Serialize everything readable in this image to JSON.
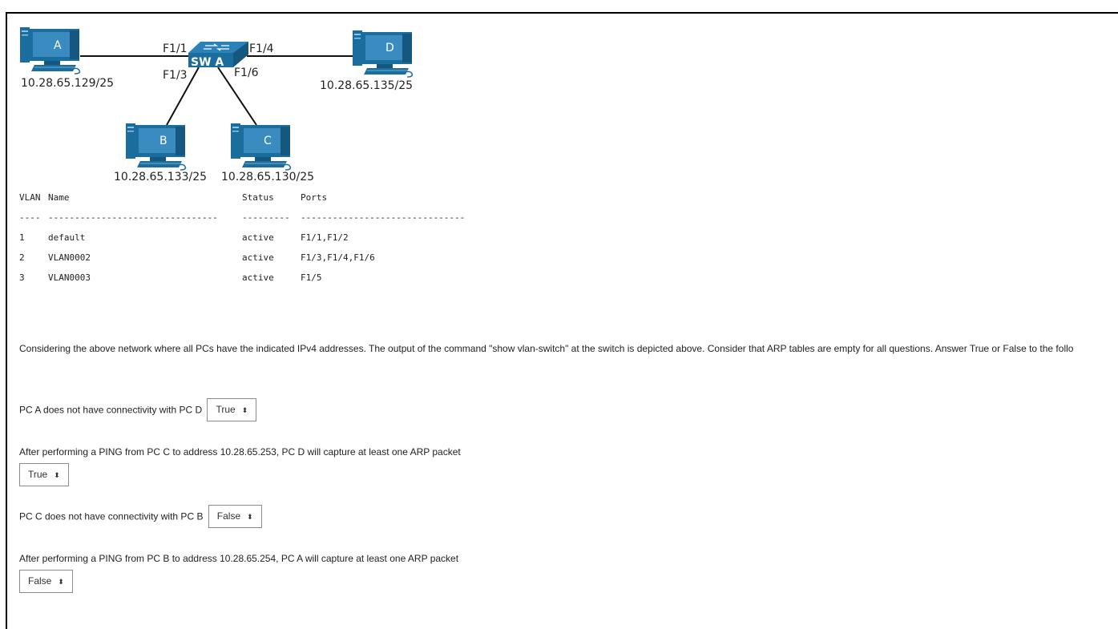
{
  "diagram": {
    "switch_label": "SW A",
    "pcs": [
      {
        "id": "A",
        "ip": "10.28.65.129/25"
      },
      {
        "id": "B",
        "ip": "10.28.65.133/25"
      },
      {
        "id": "C",
        "ip": "10.28.65.130/25"
      },
      {
        "id": "D",
        "ip": "10.28.65.135/25"
      }
    ],
    "ports": {
      "a": "F1/1",
      "b": "F1/3",
      "c": "F1/6",
      "d": "F1/4"
    },
    "colors": {
      "device": "#1b6d9e",
      "line": "#111111"
    }
  },
  "vlan_table": {
    "headers": [
      "VLAN",
      "Name",
      "Status",
      "Ports"
    ],
    "separator": [
      "----",
      "--------------------------------",
      "---------",
      "-------------------------------"
    ],
    "rows": [
      [
        "1",
        "default",
        "active",
        "F1/1,F1/2"
      ],
      [
        "2",
        "VLAN0002",
        "active",
        "F1/3,F1/4,F1/6"
      ],
      [
        "3",
        "VLAN0003",
        "active",
        "F1/5"
      ]
    ]
  },
  "intro": "Considering the above network where all PCs have the indicated IPv4 addresses. The output of the command \"show vlan-switch\" at the switch is depicted above. Consider that ARP tables are empty for all questions. Answer True or False to the follo",
  "questions": [
    {
      "text": "PC A does not have connectivity with PC D",
      "answer": "True"
    },
    {
      "text": "After performing a PING from PC C to address 10.28.65.253, PC D will capture at least one ARP packet",
      "answer": "True"
    },
    {
      "text": "PC C does not have connectivity with PC B",
      "answer": "False"
    },
    {
      "text": "After performing a PING from PC B to address 10.28.65.254, PC A will capture at least one ARP packet",
      "answer": "False"
    }
  ],
  "select_arrow": "⬍"
}
